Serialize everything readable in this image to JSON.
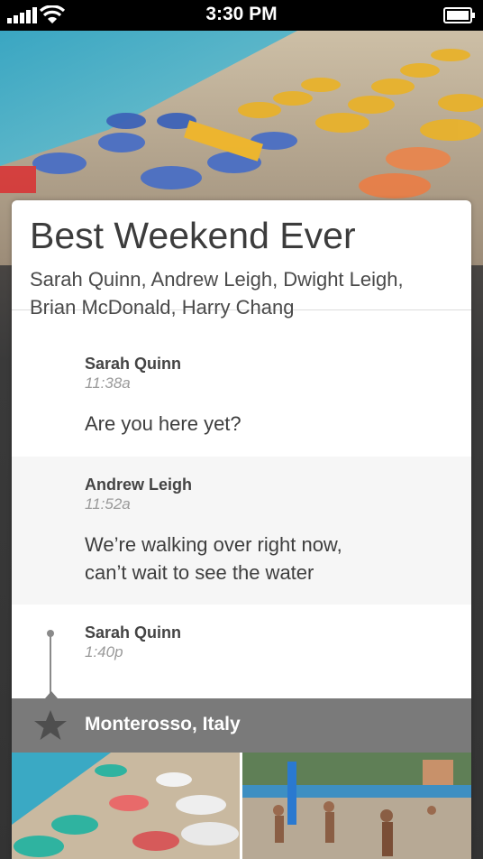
{
  "status_bar": {
    "time": "3:30 PM"
  },
  "event": {
    "title": "Best Weekend Ever",
    "participants": "Sarah Quinn, Andrew Leigh, Dwight Leigh, Brian McDonald, Harry Chang"
  },
  "messages": [
    {
      "sender": "Sarah Quinn",
      "time": "11:38a",
      "text": "Are you here yet?"
    },
    {
      "sender": "Andrew Leigh",
      "time": "11:52a",
      "text_line1": "We’re walking over right now,",
      "text_line2": "can’t wait to see the water"
    },
    {
      "sender": "Sarah Quinn",
      "time": "1:40p"
    }
  ],
  "location": {
    "label": "Monterosso, Italy",
    "icon": "star-icon"
  },
  "colors": {
    "location_bar": "#7a7a7a",
    "timeline": "#8a8a8a"
  }
}
